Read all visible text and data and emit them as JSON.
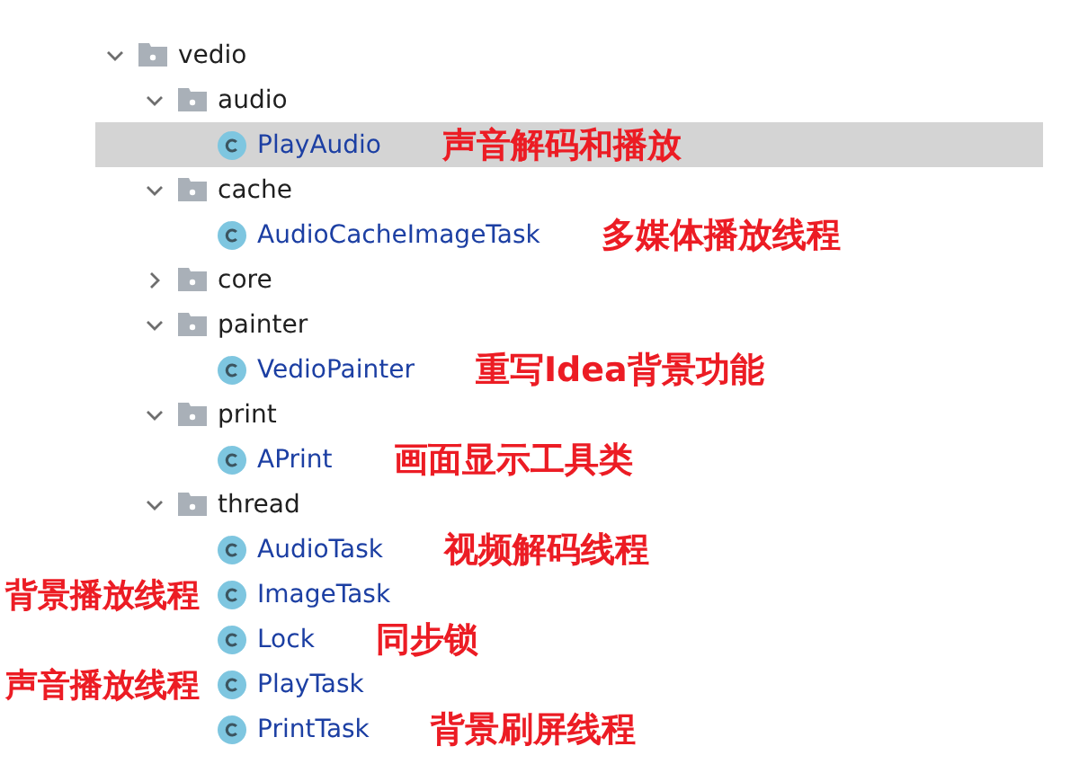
{
  "tree": [
    {
      "name": "vedio",
      "kind": "folder",
      "expanded": true,
      "selected": false,
      "children": [
        {
          "name": "audio",
          "kind": "folder",
          "expanded": true,
          "selected": false,
          "children": [
            {
              "name": "PlayAudio",
              "kind": "class",
              "selected": true,
              "note_right": "声音解码和播放"
            }
          ]
        },
        {
          "name": "cache",
          "kind": "folder",
          "expanded": true,
          "selected": false,
          "children": [
            {
              "name": "AudioCacheImageTask",
              "kind": "class",
              "selected": false,
              "note_right": "多媒体播放线程"
            }
          ]
        },
        {
          "name": "core",
          "kind": "folder",
          "expanded": false,
          "selected": false
        },
        {
          "name": "painter",
          "kind": "folder",
          "expanded": true,
          "selected": false,
          "children": [
            {
              "name": "VedioPainter",
              "kind": "class",
              "selected": false,
              "note_right": "重写Idea背景功能"
            }
          ]
        },
        {
          "name": "print",
          "kind": "folder",
          "expanded": true,
          "selected": false,
          "children": [
            {
              "name": "APrint",
              "kind": "class",
              "selected": false,
              "note_right": "画面显示工具类"
            }
          ]
        },
        {
          "name": "thread",
          "kind": "folder",
          "expanded": true,
          "selected": false,
          "children": [
            {
              "name": "AudioTask",
              "kind": "class",
              "selected": false,
              "note_right": "视频解码线程"
            },
            {
              "name": "ImageTask",
              "kind": "class",
              "selected": false,
              "note_left": "背景播放线程"
            },
            {
              "name": "Lock",
              "kind": "class",
              "selected": false,
              "note_right": "同步锁"
            },
            {
              "name": "PlayTask",
              "kind": "class",
              "selected": false,
              "note_left": "声音播放线程"
            },
            {
              "name": "PrintTask",
              "kind": "class",
              "selected": false,
              "note_right": "背景刷屏线程"
            }
          ]
        }
      ]
    }
  ]
}
